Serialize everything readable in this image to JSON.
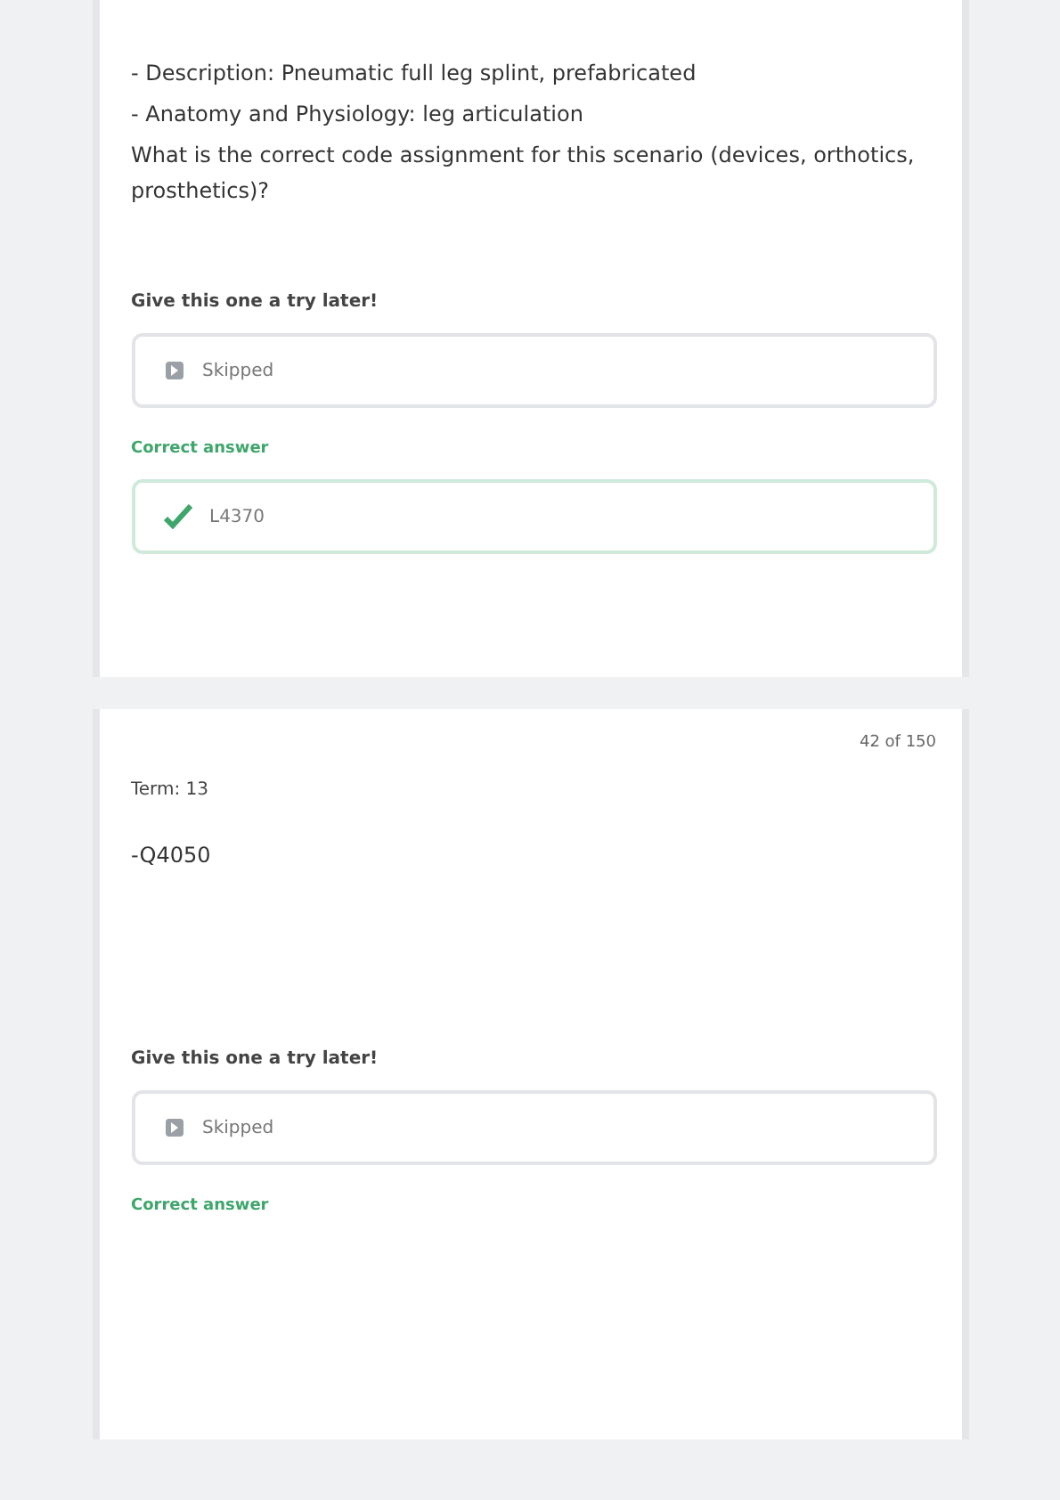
{
  "cards": [
    {
      "lines": [
        "- Description: Pneumatic full leg splint, prefabricated",
        "- Anatomy and Physiology: leg articulation",
        "What is the correct code assignment for this scenario (devices, orthotics, prosthetics)?"
      ],
      "prompt": "Give this one a try later!",
      "answer": "Skipped",
      "correct_label": "Correct answer",
      "correct_answer": "L4370"
    },
    {
      "counter": "42 of 150",
      "heading": "Term: 13",
      "lines": [
        "-Q4050"
      ],
      "prompt": "Give this one a try later!",
      "answer": "Skipped",
      "correct_label": "Correct answer"
    }
  ]
}
